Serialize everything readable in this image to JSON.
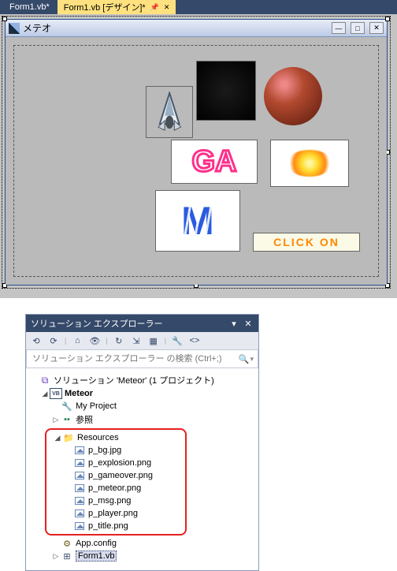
{
  "tabs": {
    "inactive": "Form1.vb*",
    "active": "Form1.vb [デザイン]*"
  },
  "form": {
    "title": "メテオ"
  },
  "preview": {
    "gameover": "GA",
    "title": "M",
    "msg": "CLICK  ON"
  },
  "explorer": {
    "title": "ソリューション エクスプローラー",
    "search_placeholder": "ソリューション エクスプローラー の検索 (Ctrl+;)",
    "root": "ソリューション 'Meteor' (1 プロジェクト)",
    "project": "Meteor",
    "myproject": "My Project",
    "refs": "参照",
    "resources": "Resources",
    "files": {
      "bg": "p_bg.jpg",
      "explosion": "p_explosion.png",
      "gameover": "p_gameover.png",
      "meteor": "p_meteor.png",
      "msg": "p_msg.png",
      "player": "p_player.png",
      "title": "p_title.png"
    },
    "appconfig": "App.config",
    "form1": "Form1.vb"
  }
}
